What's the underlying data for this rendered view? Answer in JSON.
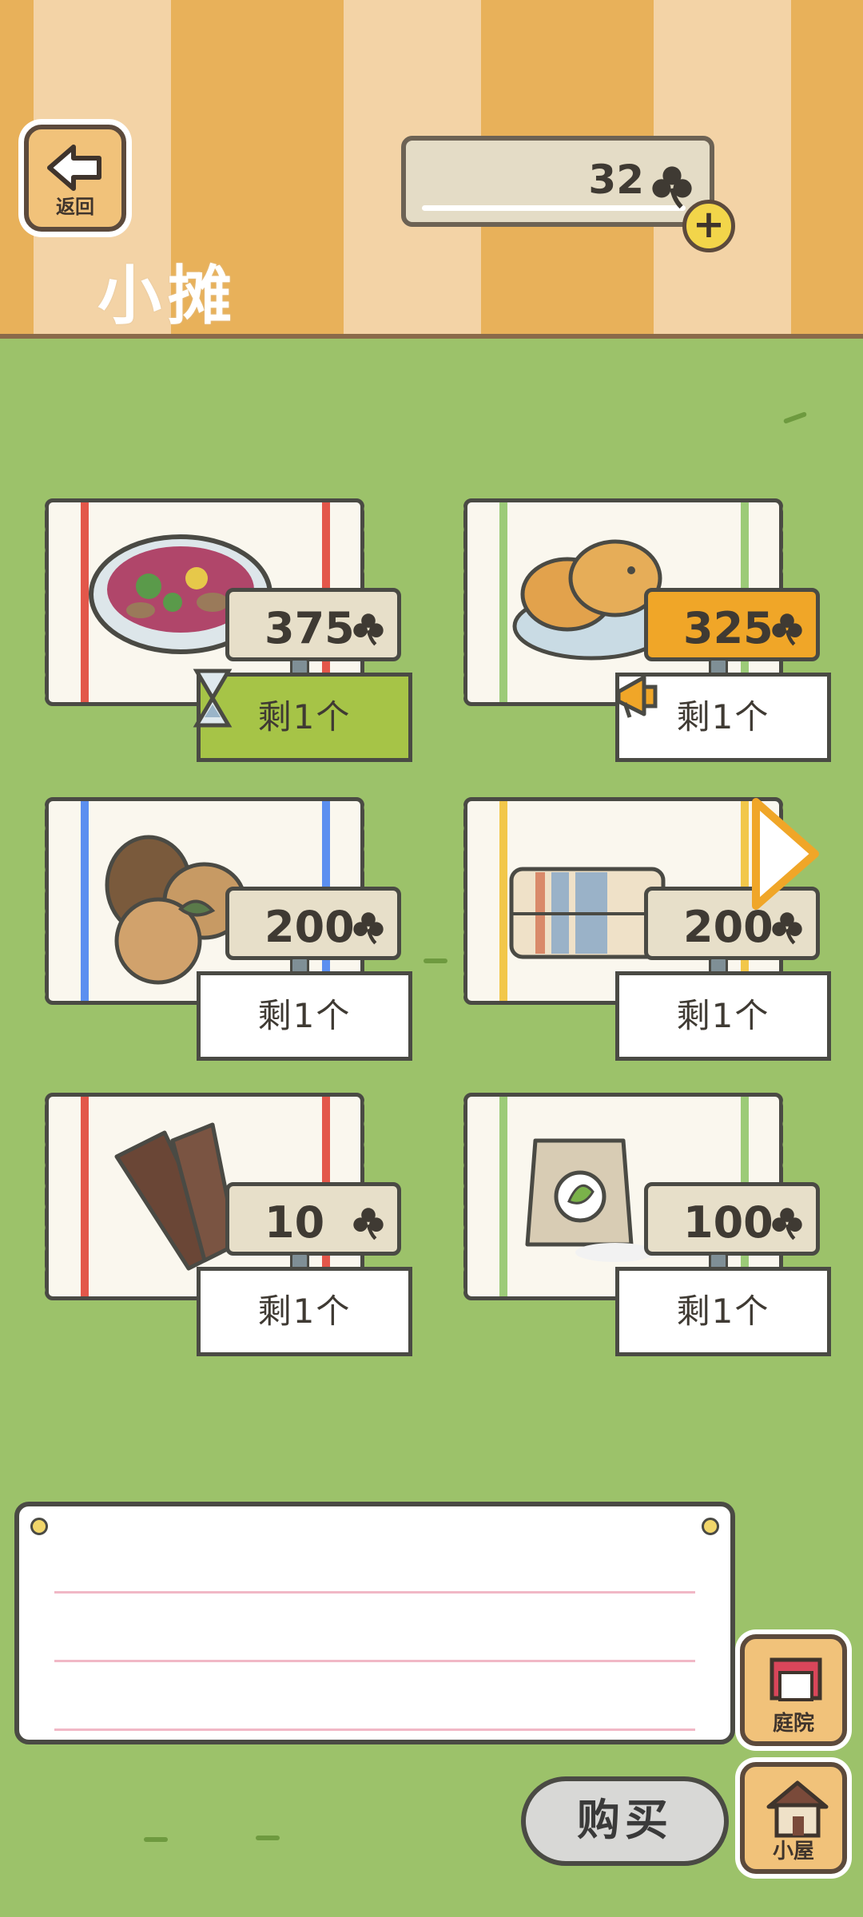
{
  "header": {
    "back_label": "返回",
    "title": "小摊",
    "clover_count": "32",
    "add_label": "+"
  },
  "items": [
    {
      "name": "mushroom-soup",
      "price": "375",
      "stock": "剩1个",
      "stripe_color": "#e3574a",
      "stock_style": "green",
      "badge": "hourglass-icon"
    },
    {
      "name": "taiyaki",
      "price": "325",
      "stock": "剩1个",
      "stripe_color": "#9ccb78",
      "stock_style": "white",
      "badge": "megaphone-icon"
    },
    {
      "name": "pinecone-nuts",
      "price": "200",
      "stock": "剩1个",
      "stripe_color": "#5b8ff0",
      "stock_style": "white"
    },
    {
      "name": "striped-blanket",
      "price": "200",
      "stock": "剩1个",
      "stripe_color": "#f2c74a",
      "stock_style": "white"
    },
    {
      "name": "wood-pieces",
      "price": "10",
      "stock": "剩1个",
      "stripe_color": "#e3574a",
      "stock_style": "white"
    },
    {
      "name": "seed-bag",
      "price": "100",
      "stock": "剩1个",
      "stripe_color": "#9ccb78",
      "stock_style": "white"
    }
  ],
  "footer": {
    "buy_label": "购买",
    "yard_label": "庭院",
    "house_label": "小屋"
  },
  "colors": {
    "grass": "#9cc26a",
    "header_orange": "#e8b15a",
    "header_cream": "#f3d3a6",
    "price_highlight": "#f0a628",
    "stock_green": "#a6c447"
  }
}
